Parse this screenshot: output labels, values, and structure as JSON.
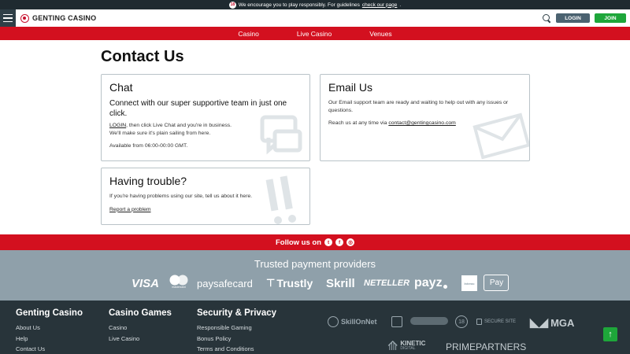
{
  "topbar": {
    "notice": "We encourage you to play responsibly. For guidelines",
    "link": "check our page",
    "period": ".",
    "badge": "18"
  },
  "header": {
    "brand": "GENTING CASINO",
    "login_label": "LOGIN",
    "join_label": "JOIN"
  },
  "nav": {
    "items": [
      "Casino",
      "Live Casino",
      "Venues"
    ]
  },
  "page_title": "Contact Us",
  "chat": {
    "title": "Chat",
    "lead": "Connect with our super supportive team in just one click.",
    "login_link": "LOGIN",
    "line1_rest": ", then click Live Chat and you're in business.",
    "line2": "We'll make sure it's plain sailing from here.",
    "availability": "Available from 06:00-00:00 GMT."
  },
  "email": {
    "title": "Email Us",
    "body": "Our Email support team are ready and waiting to help out with any issues or questions.",
    "reach_prefix": "Reach us at any time via",
    "address": "contact@gentingcasino.com"
  },
  "trouble": {
    "title": "Having trouble?",
    "body": "If you're having problems using our site, tell us about it here.",
    "link": "Report a problem"
  },
  "follow": {
    "label": "Follow us on"
  },
  "payments": {
    "title": "Trusted payment providers",
    "providers": [
      "VISA",
      "mastercard",
      "paysafecard",
      "Trustly",
      "Skrill",
      "NETELLER",
      "payz",
      "Interac",
      "Pay"
    ]
  },
  "footer": {
    "col1": {
      "title": "Genting Casino",
      "links": [
        "About Us",
        "Help",
        "Contact Us"
      ]
    },
    "col2": {
      "title": "Casino Games",
      "links": [
        "Casino",
        "Live Casino"
      ]
    },
    "col3": {
      "title": "Security & Privacy",
      "links": [
        "Responsible Gaming",
        "Bonus Policy",
        "Terms and Conditions"
      ]
    },
    "logos": {
      "skillonnet": "SkillOnNet",
      "secure": "SECURE SITE",
      "age": "18",
      "mga": "MGA",
      "kinetic": "KINETIC",
      "kinetic_sub": "DIGITAL",
      "prime": "PRIMEPARTNERS"
    }
  },
  "colors": {
    "brand_red": "#d3101f",
    "join_green": "#1ea63a",
    "login_slate": "#4b6270",
    "footer_bg": "#28343a",
    "payments_bg": "#8fa0aa"
  }
}
